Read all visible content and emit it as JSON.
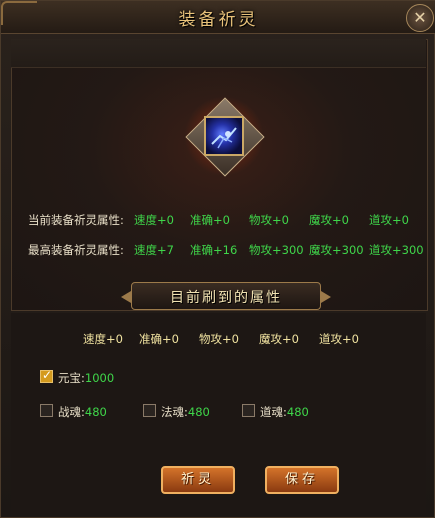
{
  "window": {
    "title": "装备祈灵",
    "close_glyph": "✕"
  },
  "current_attrs": {
    "label": "当前装备祈灵属性:",
    "values": [
      "速度+0",
      "准确+0",
      "物攻+0",
      "魔攻+0",
      "道攻+0"
    ]
  },
  "max_attrs": {
    "label": "最高装备祈灵属性:",
    "values": [
      "速度+7",
      "准确+16",
      "物攻+300",
      "魔攻+300",
      "道攻+300"
    ]
  },
  "banner": {
    "text": "目前刷到的属性"
  },
  "refreshed_attrs": [
    "速度+0",
    "准确+0",
    "物攻+0",
    "魔攻+0",
    "道攻+0"
  ],
  "costs": [
    {
      "label": "元宝",
      "value": "1000",
      "checked": true
    },
    {
      "label": "战魂",
      "value": "480",
      "checked": false
    },
    {
      "label": "法魂",
      "value": "480",
      "checked": false
    },
    {
      "label": "道魂",
      "value": "480",
      "checked": false
    }
  ],
  "buttons": {
    "pray": "祈灵",
    "save": "保存"
  },
  "colors": {
    "green_value": "#3fd64a",
    "gold_text": "#e8c27a",
    "button_orange": "#d4732a"
  },
  "icons": {
    "item": "blue-crystal-equipment-icon"
  }
}
